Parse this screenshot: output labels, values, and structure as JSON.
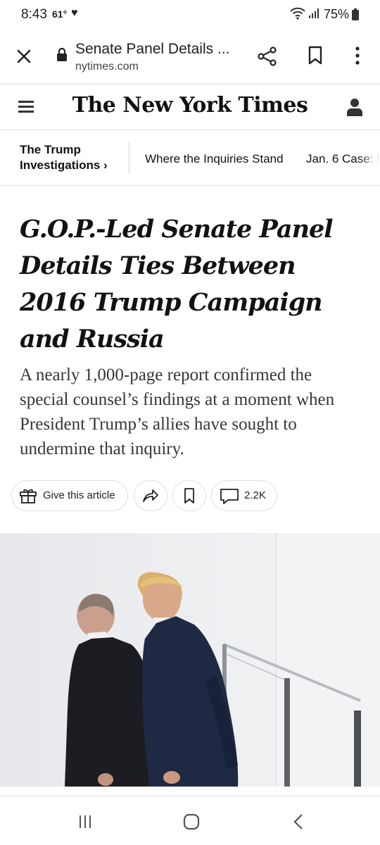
{
  "status_bar": {
    "time": "8:43",
    "temperature": "61°",
    "battery": "75%"
  },
  "toolbar": {
    "title": "Senate Panel Details ...",
    "url": "nytimes.com"
  },
  "masthead": {
    "logo": "The New York Times"
  },
  "section_nav": {
    "section_line1": "The Trump",
    "section_line2": "Investigations ›",
    "links": [
      "Where the Inquiries Stand",
      "Jan. 6 Case: F"
    ]
  },
  "article": {
    "headline": "G.O.P.-Led Senate Panel Details Ties Between 2016 Trump Campaign and Russia",
    "summary": "A nearly 1,000-page report confirmed the special counsel’s findings at a moment when President Trump’s allies have sought to undermine that inquiry."
  },
  "actions": {
    "gift_label": "Give this article",
    "comment_count": "2.2K"
  }
}
